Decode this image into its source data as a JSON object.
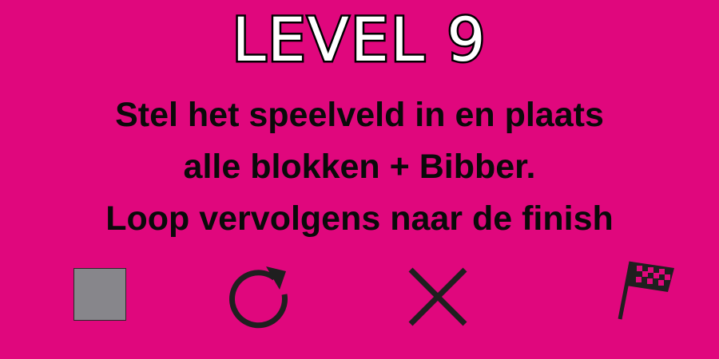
{
  "level": {
    "title": "LEVEL 9"
  },
  "instructions": {
    "lines": [
      "Stel het speelveld in en plaats",
      "alle blokken + Bibber.",
      "Loop vervolgens naar de finish"
    ]
  },
  "controls": {
    "items": [
      {
        "name": "stop",
        "icon": "stop-square-icon"
      },
      {
        "name": "restart",
        "icon": "restart-icon"
      },
      {
        "name": "close",
        "icon": "close-icon"
      },
      {
        "name": "finish",
        "icon": "finish-flag-icon"
      }
    ]
  },
  "colors": {
    "background": "#E0077D",
    "title_fill": "#FFFFFF",
    "title_stroke": "#000000",
    "text": "#0A0A0A",
    "stop_square": "#87868B"
  }
}
